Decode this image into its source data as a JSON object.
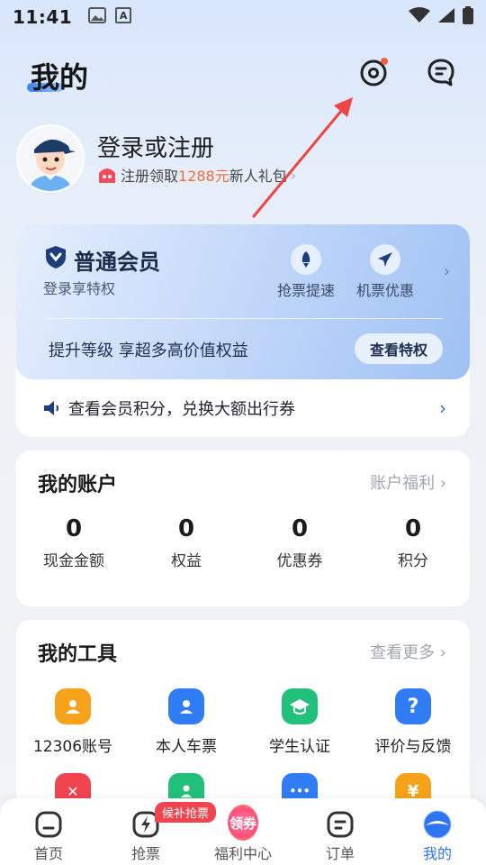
{
  "status_bar": {
    "time": "11:41",
    "left_icon_2": "A"
  },
  "header": {
    "title": "我的"
  },
  "profile": {
    "login_text": "登录或注册",
    "gift_prefix": "注册领取",
    "gift_highlight": "1288元",
    "gift_suffix": "新人礼包",
    "gift_chevron": "›"
  },
  "member": {
    "level": "普通会员",
    "subtitle": "登录享特权",
    "perks": [
      "抢票提速",
      "机票优惠"
    ],
    "chevron": "›",
    "upgrade_text": "提升等级 享超多高价值权益",
    "privilege_button": "查看特权",
    "points_text": "查看会员积分，兑换大额出行券",
    "points_chevron": "›"
  },
  "account": {
    "title": "我的账户",
    "link": "账户福利 ›",
    "stats": [
      {
        "value": "0",
        "label": "现金金额"
      },
      {
        "value": "0",
        "label": "权益"
      },
      {
        "value": "0",
        "label": "优惠券"
      },
      {
        "value": "0",
        "label": "积分"
      }
    ]
  },
  "tools": {
    "title": "我的工具",
    "link": "查看更多 ›",
    "items": [
      {
        "label": "12306账号",
        "color": "#f7a21b"
      },
      {
        "label": "本人车票",
        "color": "#2f7cf5"
      },
      {
        "label": "学生认证",
        "color": "#22c07a"
      },
      {
        "label": "评价与反馈",
        "color": "#2f7cf5"
      }
    ],
    "row2_colors": [
      "#f0444f",
      "#22c07a",
      "#2f7cf5",
      "#f7a21b"
    ],
    "row2_glyphs": [
      "✕",
      "",
      "•••",
      "¥"
    ]
  },
  "bottom_nav": {
    "items": [
      "首页",
      "抢票",
      "福利中心",
      "订单",
      "我的"
    ],
    "badge": "候补抢票",
    "welfare_badge": "领券",
    "active_color": "#2f74f0"
  },
  "colors": {
    "accent": "#2f74f0",
    "highlight": "#f26b3a",
    "annotation": "#ef4444"
  }
}
